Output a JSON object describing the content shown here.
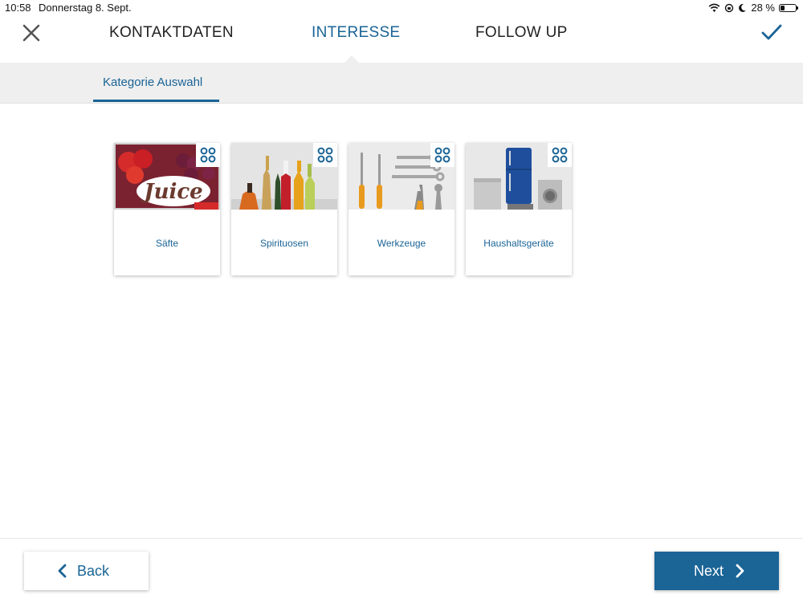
{
  "status_bar": {
    "time": "10:58",
    "date": "Donnerstag 8. Sept.",
    "battery": "28 %",
    "battery_level": 0.28,
    "icons": [
      "wifi-icon",
      "lock-rotation-icon",
      "moon-icon",
      "battery-icon"
    ]
  },
  "header": {
    "tabs": [
      {
        "label": "KONTAKTDATEN",
        "active": false
      },
      {
        "label": "INTERESSE",
        "active": true
      },
      {
        "label": "FOLLOW UP",
        "active": false
      }
    ],
    "close_icon": "close-icon",
    "confirm_icon": "checkmark-icon"
  },
  "subheader": {
    "tab_label": "Kategorie Auswahl"
  },
  "categories": [
    {
      "label": "Säfte",
      "image_text": "Juice",
      "icon": "grid-icon"
    },
    {
      "label": "Spirituosen",
      "icon": "grid-icon"
    },
    {
      "label": "Werkzeuge",
      "icon": "grid-icon"
    },
    {
      "label": "Haushaltsgeräte",
      "icon": "grid-icon"
    }
  ],
  "footer": {
    "back_label": "Back",
    "next_label": "Next"
  },
  "colors": {
    "accent": "#1a6496",
    "subheader_bg": "#efefef",
    "text_dark": "#222222"
  }
}
